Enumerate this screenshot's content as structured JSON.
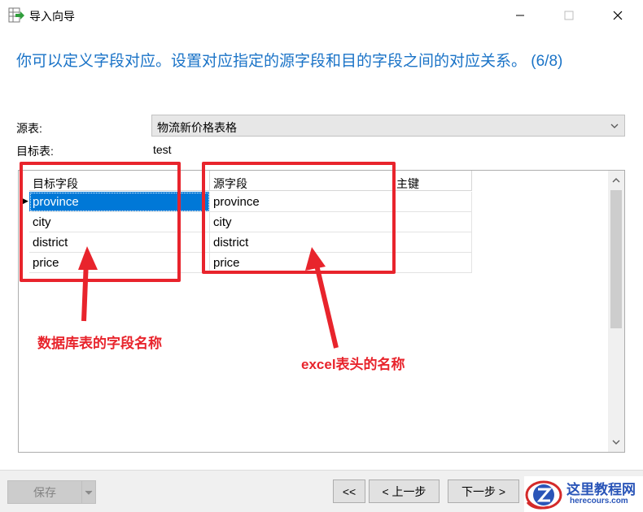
{
  "window": {
    "title": "导入向导",
    "icon": "import-wizard-icon"
  },
  "heading": "你可以定义字段对应。设置对应指定的源字段和目的字段之间的对应关系。 (6/8)",
  "form": {
    "source_label": "源表:",
    "source_value": "物流新价格表格",
    "target_label": "目标表:",
    "target_value": "test"
  },
  "grid": {
    "headers": [
      "目标字段",
      "源字段",
      "主键"
    ],
    "rows": [
      {
        "target": "province",
        "source": "province",
        "key": ""
      },
      {
        "target": "city",
        "source": "city",
        "key": ""
      },
      {
        "target": "district",
        "source": "district",
        "key": ""
      },
      {
        "target": "price",
        "source": "price",
        "key": ""
      }
    ],
    "selected_row": 0
  },
  "annotations": {
    "left": "数据库表的字段名称",
    "right": "excel表头的名称",
    "color": "#e8242c"
  },
  "footer": {
    "save_label": "保存",
    "first_label": "<<",
    "prev_label": "< 上一步",
    "next_label": "下一步 >"
  },
  "watermark": {
    "title": "这里教程网",
    "url": "herecours.com",
    "logo": "z-logo"
  },
  "colors": {
    "heading": "#1a73c7",
    "selection": "#0078d7"
  }
}
